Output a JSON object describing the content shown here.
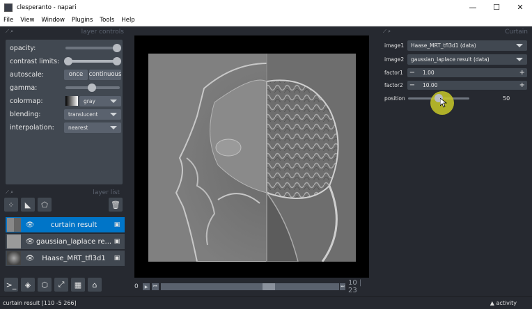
{
  "window": {
    "title": "clesperanto - napari",
    "minimize": "—",
    "maximize": "☐",
    "close": "✕"
  },
  "menu": [
    "File",
    "View",
    "Window",
    "Plugins",
    "Tools",
    "Help"
  ],
  "layer_controls": {
    "header": "layer controls",
    "opacity_label": "opacity:",
    "opacity_value": 1.0,
    "contrast_label": "contrast limits:",
    "autoscale_label": "autoscale:",
    "autoscale_once": "once",
    "autoscale_continuous": "continuous",
    "gamma_label": "gamma:",
    "colormap_label": "colormap:",
    "colormap_value": "gray",
    "blending_label": "blending:",
    "blending_value": "translucent",
    "interpolation_label": "interpolation:",
    "interpolation_value": "nearest"
  },
  "layer_list": {
    "header": "layer list",
    "layers": [
      {
        "name": "curtain result",
        "selected": true
      },
      {
        "name": "gaussian_laplace re...",
        "selected": false
      },
      {
        "name": "Haase_MRT_tfl3d1",
        "selected": false
      }
    ]
  },
  "dims": {
    "start": "0",
    "current": "10",
    "total": "23"
  },
  "curtain": {
    "header": "Curtain",
    "image1_label": "image1",
    "image1_value": "Haase_MRT_tfl3d1 (data)",
    "image2_label": "image2",
    "image2_value": "gaussian_laplace result (data)",
    "factor1_label": "factor1",
    "factor1_value": "1.00",
    "factor2_label": "factor2",
    "factor2_value": "10.00",
    "position_label": "position",
    "position_value": "50"
  },
  "status": {
    "text": "curtain result [110  -5 266]",
    "activity": "activity"
  },
  "icons": [
    "napari-icon",
    "eye-icon",
    "image-layer-icon",
    "trash-icon",
    "new-points-icon",
    "new-shapes-icon",
    "new-labels-icon",
    "console-icon",
    "ndisplay-icon",
    "roll-icon",
    "transpose-icon",
    "grid-icon",
    "home-icon",
    "play-icon",
    "step-icon"
  ]
}
